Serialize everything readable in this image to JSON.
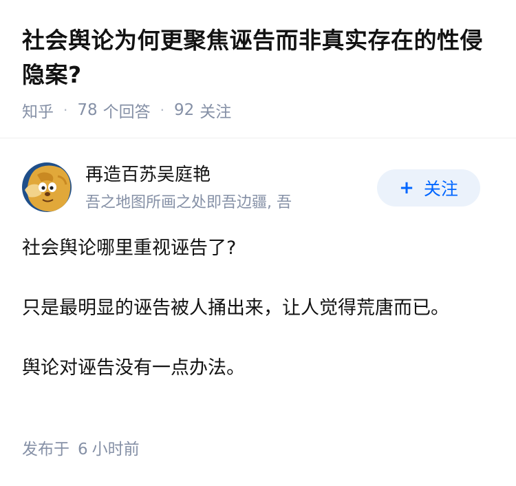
{
  "question": {
    "title": "社会舆论为何更聚焦诬告而非真实存在的性侵隐案?",
    "source": "知乎",
    "answer_count": "78",
    "answer_label": "个回答",
    "follower_count": "92",
    "follower_label": "关注"
  },
  "author": {
    "name": "再造百苏吴庭艳",
    "bio": "吾之地图所画之处即吾边疆, 吾",
    "follow_label": "关注",
    "follow_icon": "plus-icon",
    "avatar_icon": "cartoon-lion-avatar"
  },
  "answer": {
    "paragraphs": [
      "社会舆论哪里重视诬告了?",
      "只是最明显的诬告被人捅出来，让人觉得荒唐而已。",
      "舆论对诬告没有一点办法。"
    ],
    "published_prefix": "发布于",
    "published_num": "6",
    "published_unit": "小时前"
  },
  "colors": {
    "accent": "#0066ff",
    "follow_bg": "#ebf2fb",
    "meta_text": "#8590a6",
    "body_text": "#121212"
  }
}
